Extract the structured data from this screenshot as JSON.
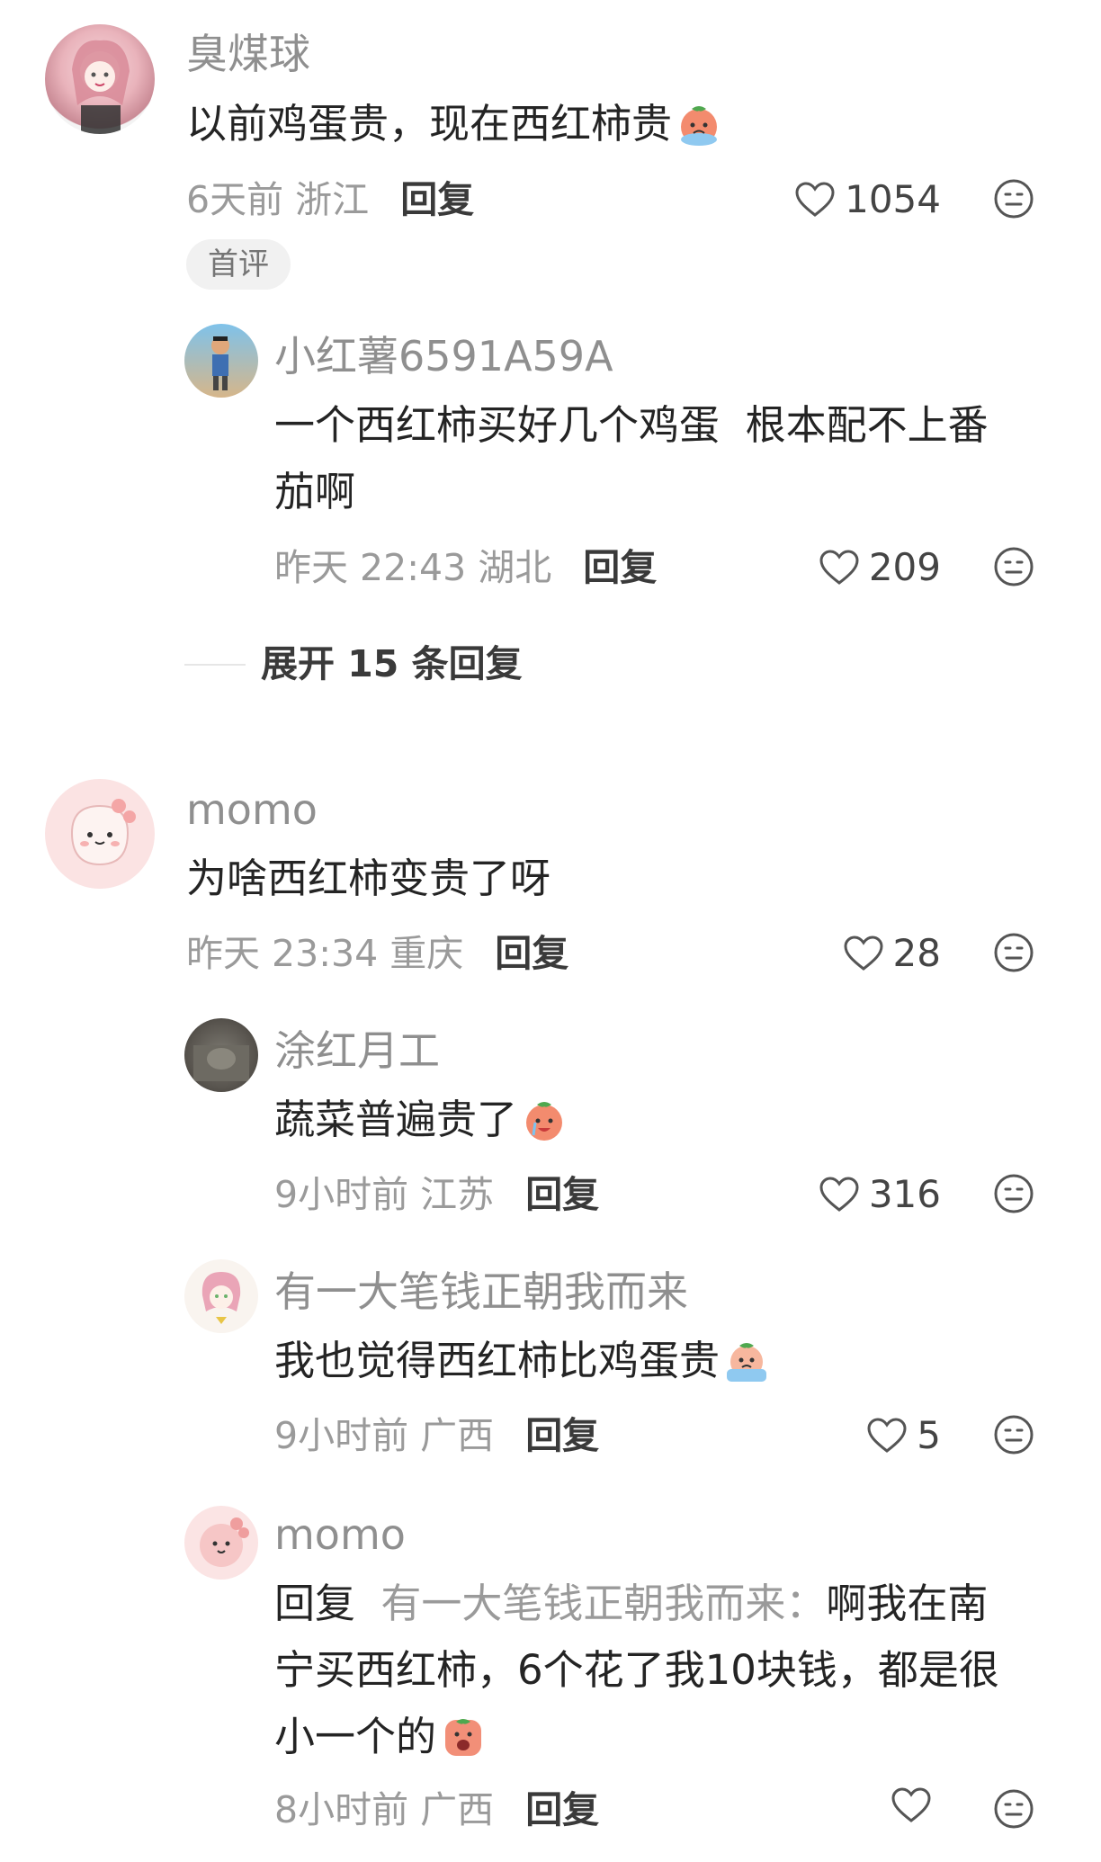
{
  "comments": [
    {
      "user": "臭煤球",
      "content": "以前鸡蛋贵，现在西红柿贵",
      "time": "6天前",
      "location": "浙江",
      "reply_label": "回复",
      "likes": "1054",
      "badge": "首评",
      "replies": [
        {
          "user": "小红薯6591A59A",
          "content_line1": "一个西红柿买好几个鸡蛋  根本配不上番",
          "content_line2": "茄啊",
          "time": "昨天 22:43",
          "location": "湖北",
          "reply_label": "回复",
          "likes": "209"
        }
      ],
      "expand_label": "展开 15 条回复"
    },
    {
      "user": "momo",
      "content": "为啥西红柿变贵了呀",
      "time": "昨天 23:34",
      "location": "重庆",
      "reply_label": "回复",
      "likes": "28",
      "replies": [
        {
          "user": "涂红月工",
          "content": "蔬菜普遍贵了",
          "time": "9小时前",
          "location": "江苏",
          "reply_label": "回复",
          "likes": "316"
        },
        {
          "user": "有一大笔钱正朝我而来",
          "content": "我也觉得西红柿比鸡蛋贵",
          "time": "9小时前",
          "location": "广西",
          "reply_label": "回复",
          "likes": "5"
        },
        {
          "user": "momo",
          "reply_prefix": "回复",
          "reply_target": "有一大笔钱正朝我而来：",
          "content_line1": "啊我在南",
          "content_line2": "宁买西红柿，6个花了我10块钱，都是很",
          "content_line3": "小一个的",
          "time": "8小时前",
          "location": "广西",
          "reply_label": "回复",
          "likes": ""
        }
      ]
    }
  ],
  "icons": {
    "like": "heart-outline-icon",
    "emoji": "emoji-face-icon",
    "sticker": "tomato-crying-sticker"
  },
  "colors": {
    "name": "#8f8f8f",
    "meta": "#9a9a9a",
    "text": "#242424",
    "badge_bg": "#f1f1f1"
  }
}
